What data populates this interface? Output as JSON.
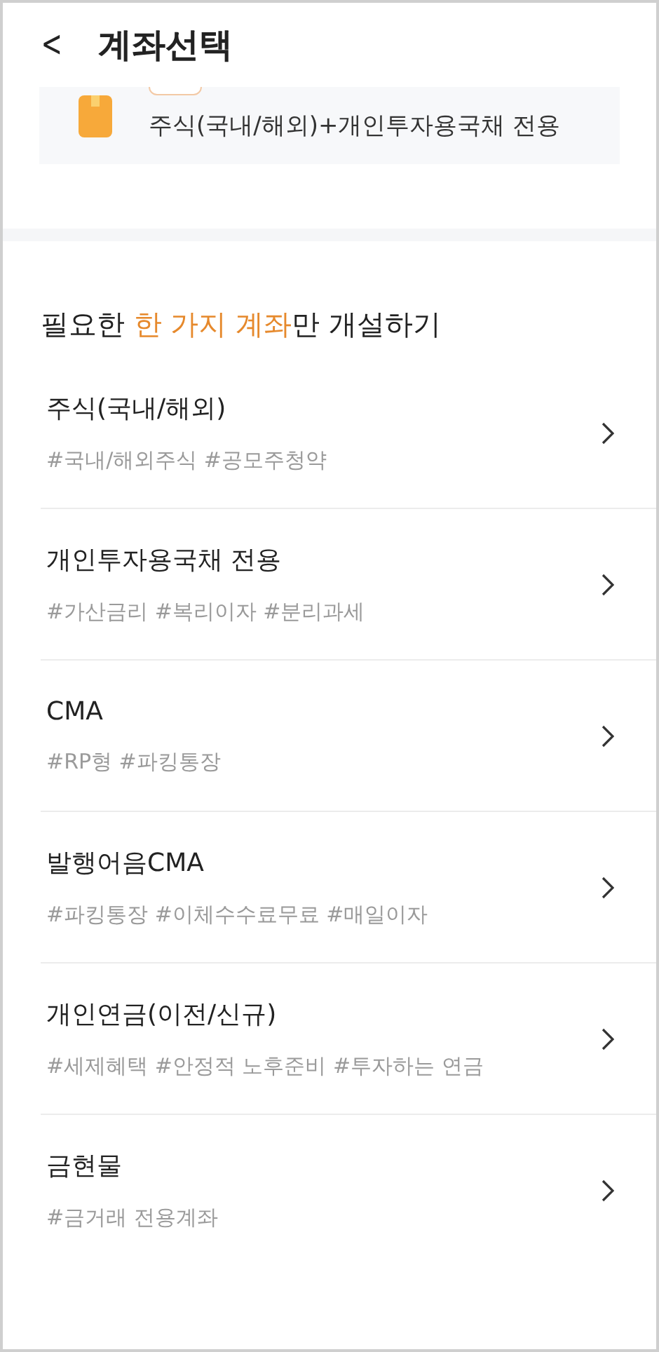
{
  "header": {
    "back": "<",
    "title": "계좌선택"
  },
  "top_card": {
    "text": "주식(국내/해외)+개인투자용국채 전용"
  },
  "section": {
    "heading_before": "필요한 ",
    "heading_highlight": "한 가지 계좌",
    "heading_after": "만 개설하기"
  },
  "accounts": [
    {
      "name": "주식(국내/해외)",
      "tags": "#국내/해외주식 #공모주청약"
    },
    {
      "name": "개인투자용국채 전용",
      "tags": "#가산금리 #복리이자 #분리과세"
    },
    {
      "name": "CMA",
      "tags": "#RP형 #파킹통장"
    },
    {
      "name": "발행어음CMA",
      "tags": "#파킹통장 #이체수수료무료 #매일이자"
    },
    {
      "name": "개인연금(이전/신규)",
      "tags": "#세제혜택 #안정적 노후준비 #투자하는 연금"
    },
    {
      "name": "금현물",
      "tags": "#금거래 전용계좌"
    }
  ]
}
